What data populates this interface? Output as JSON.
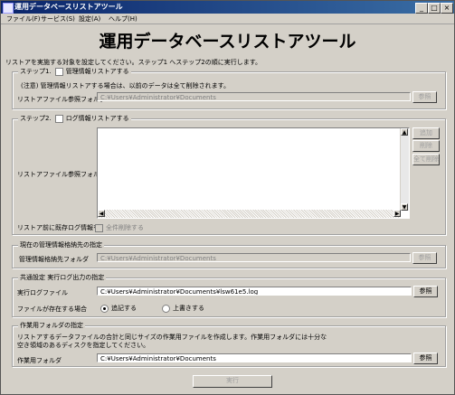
{
  "window": {
    "title": "運用データベースリストアツール",
    "minimize": "_",
    "maximize": "□",
    "close": "×"
  },
  "menu": [
    "ファイル(F)",
    "サービス(S)",
    "設定(A)",
    "ヘルプ(H)"
  ],
  "main_title": "運用データベースリストアツール",
  "intro": "リストアを実施する対象を設定してください。ステップ1 へステップ2の順に実行します。",
  "step1": {
    "legend": "ステップ1.",
    "checkbox_label": "管理情報リストアする",
    "note": "(注意) 管理情報リストアする場合は、以前のデータは全て削除されます。",
    "ref_folder_label": "リストアファイル参照フォルダ",
    "ref_folder_value": "C:¥Users¥Administrator¥Documents",
    "browse": "参照"
  },
  "step2": {
    "legend": "ステップ2.",
    "checkbox_label": "ログ情報リストアする",
    "ref_folder_label": "リストアファイル参照フォルダ",
    "add": "追加",
    "remove": "削除",
    "remove_all": "全て削除",
    "pre_delete_label": "リストア前に既存ログ情報を",
    "delete_all": "全件削除する",
    "scroll_up": "▲",
    "scroll_down": "▼",
    "scroll_left": "◀",
    "scroll_right": "▶"
  },
  "current": {
    "legend": "現在の管理情報格納先の指定",
    "label": "管理情報格納先フォルダ",
    "value": "C:¥Users¥Administrator¥Documents",
    "browse": "参照"
  },
  "common": {
    "legend": "共通設定 実行ログ出力の指定",
    "log_label": "実行ログファイル",
    "log_value": "C:¥Users¥Administrator¥Documents¥lsw61e5.log",
    "browse": "参照",
    "exists_label": "ファイルが存在する場合",
    "append": "追記する",
    "overwrite": "上書きする",
    "selected": "append"
  },
  "work": {
    "legend": "作業用フォルダの指定",
    "desc1": "リストアするデータファイルの合計と同じサイズの作業用ファイルを作成します。作業用フォルダには十分な",
    "desc2": "空き領域のあるディスクを指定してください。",
    "label": "作業用フォルダ",
    "value": "C:¥Users¥Administrator¥Documents",
    "browse": "参照"
  },
  "execute": "実行"
}
